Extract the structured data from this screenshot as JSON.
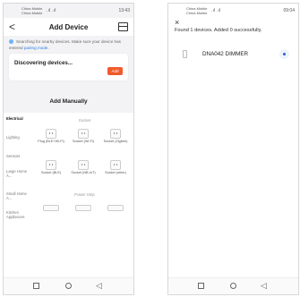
{
  "phoneA": {
    "status": {
      "carrier_line1": "China Mobile",
      "carrier_line2": "China Mobile",
      "signal": "²ᴺₓᵍᴺᴺ ▐▌ ▐▌",
      "network": "46",
      "time": "13:43",
      "battery": "▭"
    },
    "header": {
      "back": "<",
      "title": "Add Device",
      "scan_icon": "scan-icon"
    },
    "notice": {
      "text": "Searching for nearby devices. Make sure your device has entered",
      "link": "pairing mode."
    },
    "discover": {
      "title": "Discovering devices...",
      "add_label": "Add"
    },
    "manual_title": "Add Manually",
    "categories": [
      "Electrical",
      "Lighting",
      "Sensors",
      "Large Home A...",
      "Small Home A...",
      "Kitchen Appliances"
    ],
    "sections": {
      "socket": "Socket",
      "power_strip": "Power Strip"
    },
    "devices": [
      {
        "label": "Plug (BLE+Wi-Fi)"
      },
      {
        "label": "Socket (Wi-Fi)"
      },
      {
        "label": "Socket (Zigbee)"
      },
      {
        "label": "Socket (BLE)"
      },
      {
        "label": "Socket (NB-IoT)"
      },
      {
        "label": "Socket (other)"
      }
    ]
  },
  "phoneB": {
    "status": {
      "carrier_line1": "China Mobile",
      "carrier_line2": "China Mobile",
      "time": "09:04"
    },
    "close": "×",
    "found_text": "Found 1 devices. Added 0 successfully.",
    "device_name": "DNA042 DIMMER"
  }
}
